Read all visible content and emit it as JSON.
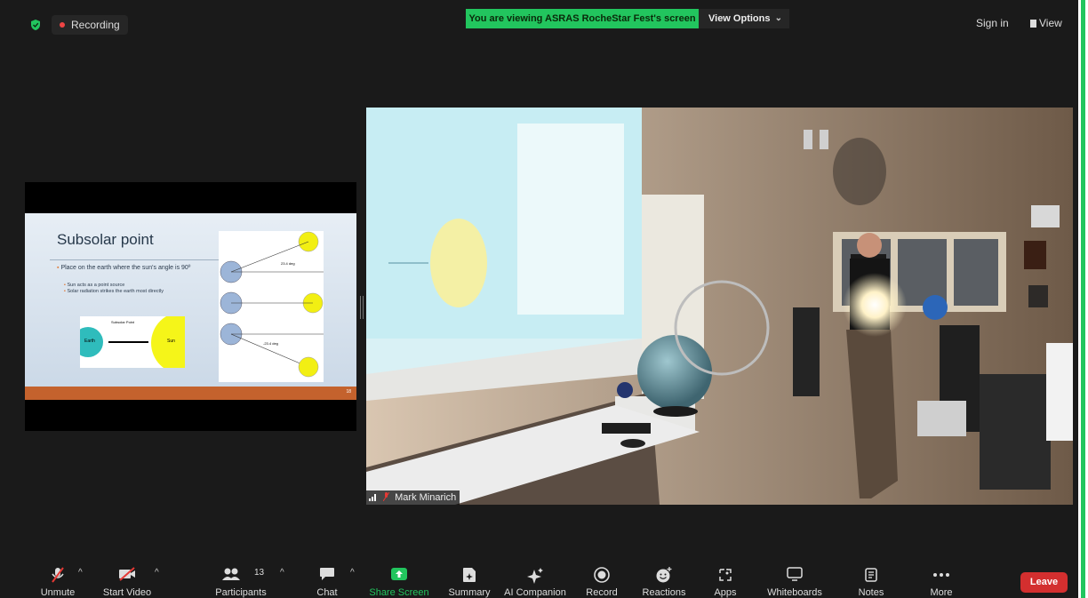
{
  "topbar": {
    "recording_label": "Recording",
    "viewing_banner": "You are viewing ASRAS RocheStar Fest's screen",
    "view_options_label": "View Options",
    "sign_in_label": "Sign in",
    "view_label": "View"
  },
  "shared_slide": {
    "title": "Subsolar point",
    "bullet_main": "Place on the earth where the sun's angle is 90º",
    "bullet_sub_1": "Sun acts as a point source",
    "bullet_sub_2": "Solar radiation strikes the earth most directly",
    "mini_subsolar_label": "Subsolar Point",
    "mini_earth_label": "Earth",
    "mini_sun_label": "Sun",
    "diagram_label_1": "23.4 deg",
    "diagram_label_2": "-23.4 deg",
    "page_number": "18"
  },
  "video": {
    "participant_name": "Mark Minarich"
  },
  "toolbar": {
    "unmute": "Unmute",
    "start_video": "Start Video",
    "participants": "Participants",
    "participant_count": "13",
    "chat": "Chat",
    "share_screen": "Share Screen",
    "summary": "Summary",
    "ai_companion": "AI Companion",
    "record": "Record",
    "reactions": "Reactions",
    "apps": "Apps",
    "whiteboards": "Whiteboards",
    "notes": "Notes",
    "more": "More",
    "leave": "Leave"
  },
  "colors": {
    "accent_green": "#22c55e",
    "leave_red": "#d32f2f",
    "record_red": "#ef4444",
    "slide_footer_orange": "#c4622d"
  }
}
